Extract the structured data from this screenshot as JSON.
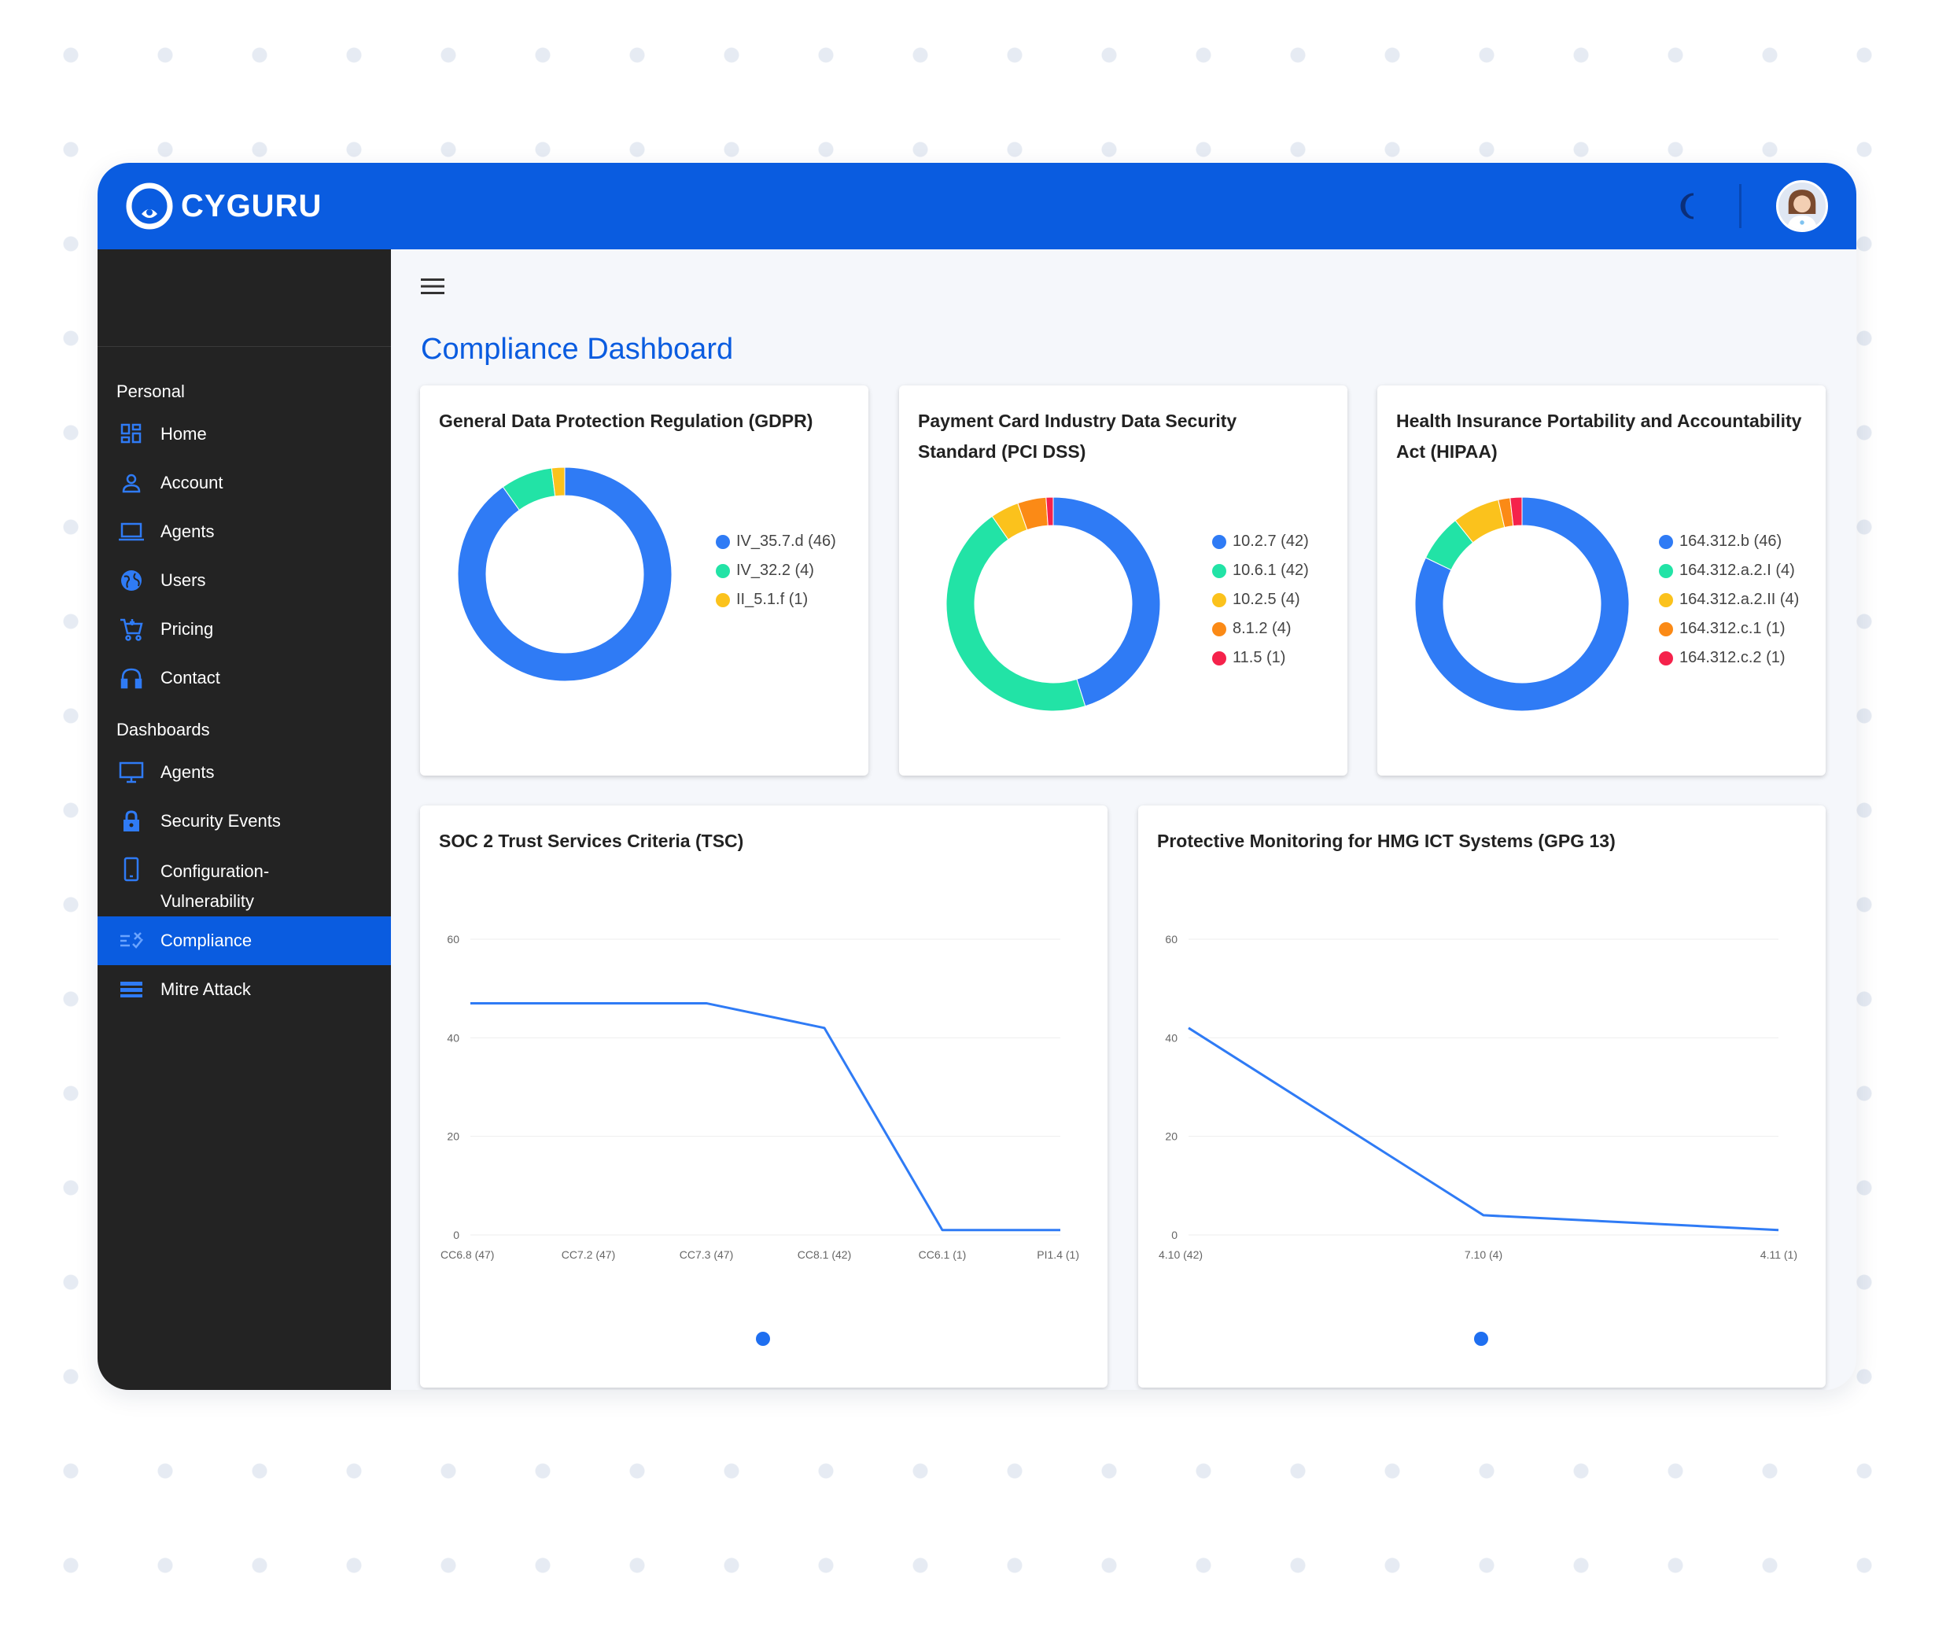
{
  "app": {
    "brand": "CYGURU"
  },
  "header": {
    "theme_icon": "moon-icon",
    "avatar_icon": "user-avatar-icon"
  },
  "sidebar": {
    "sections": [
      {
        "label": "Personal",
        "items": [
          {
            "label": "Home",
            "icon": "grid-icon"
          },
          {
            "label": "Account",
            "icon": "user-icon"
          },
          {
            "label": "Agents",
            "icon": "laptop-icon"
          },
          {
            "label": "Users",
            "icon": "globe-icon"
          },
          {
            "label": "Pricing",
            "icon": "cart-icon"
          },
          {
            "label": "Contact",
            "icon": "headset-icon"
          }
        ]
      },
      {
        "label": "Dashboards",
        "items": [
          {
            "label": "Agents",
            "icon": "monitor-icon"
          },
          {
            "label": "Security Events",
            "icon": "lock-icon"
          },
          {
            "label": "Configuration-Vulnerability",
            "icon": "phone-icon"
          },
          {
            "label": "Compliance",
            "icon": "checklist-icon",
            "active": true
          },
          {
            "label": "Mitre Attack",
            "icon": "layers-icon"
          }
        ]
      }
    ]
  },
  "page": {
    "title": "Compliance Dashboard"
  },
  "colors": {
    "blue": "#2f7bf5",
    "green": "#22e3a6",
    "yellow": "#fbc21c",
    "orange": "#fb8a16",
    "red": "#f5224b"
  },
  "chart_data": [
    {
      "type": "pie",
      "title": "General Data Protection Regulation (GDPR)",
      "labels": [
        "IV_35.7.d (46)",
        "IV_32.2 (4)",
        "II_5.1.f (1)"
      ],
      "values": [
        46,
        4,
        1
      ],
      "colors": [
        "#2f7bf5",
        "#22e3a6",
        "#fbc21c"
      ]
    },
    {
      "type": "pie",
      "title": "Payment Card Industry Data Security Standard (PCI DSS)",
      "labels": [
        "10.2.7 (42)",
        "10.6.1 (42)",
        "10.2.5 (4)",
        "8.1.2 (4)",
        "11.5 (1)"
      ],
      "values": [
        42,
        42,
        4,
        4,
        1
      ],
      "colors": [
        "#2f7bf5",
        "#22e3a6",
        "#fbc21c",
        "#fb8a16",
        "#f5224b"
      ]
    },
    {
      "type": "pie",
      "title": "Health Insurance Portability and Accountability Act (HIPAA)",
      "labels": [
        "164.312.b (46)",
        "164.312.a.2.I (4)",
        "164.312.a.2.II (4)",
        "164.312.c.1 (1)",
        "164.312.c.2 (1)"
      ],
      "values": [
        46,
        4,
        4,
        1,
        1
      ],
      "colors": [
        "#2f7bf5",
        "#22e3a6",
        "#fbc21c",
        "#fb8a16",
        "#f5224b"
      ]
    },
    {
      "type": "line",
      "title": "SOC 2 Trust Services Criteria (TSC)",
      "categories": [
        "CC6.8 (47)",
        "CC7.2 (47)",
        "CC7.3 (47)",
        "CC8.1 (42)",
        "CC6.1 (1)",
        "PI1.4 (1)"
      ],
      "values": [
        47,
        47,
        47,
        42,
        1,
        1
      ],
      "ylim": [
        0,
        60
      ],
      "yticks": [
        "0",
        "20",
        "40",
        "60"
      ],
      "grid": true
    },
    {
      "type": "line",
      "title": "Protective Monitoring for HMG ICT Systems (GPG 13)",
      "categories": [
        "4.10 (42)",
        "7.10 (4)",
        "4.11 (1)"
      ],
      "values": [
        42,
        4,
        1
      ],
      "ylim": [
        0,
        60
      ],
      "yticks": [
        "0",
        "20",
        "40",
        "60"
      ],
      "grid": true
    }
  ]
}
